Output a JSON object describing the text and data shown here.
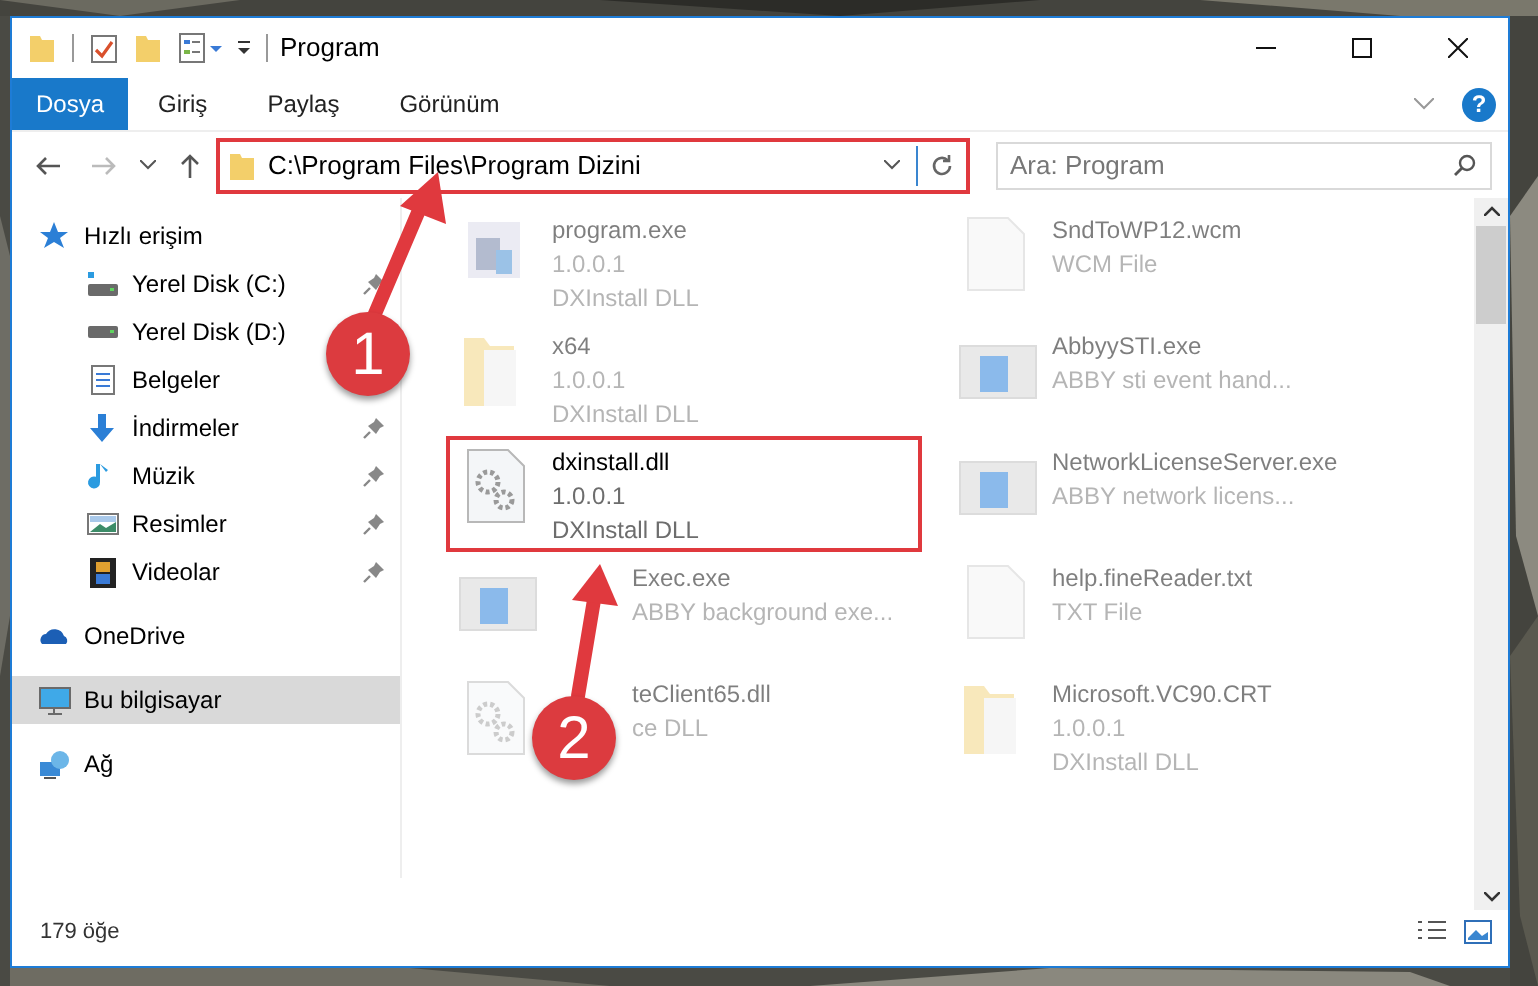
{
  "window": {
    "title": "Program"
  },
  "ribbon": {
    "tabs": [
      {
        "label": "Dosya",
        "selected": true
      },
      {
        "label": "Giriş",
        "selected": false
      },
      {
        "label": "Paylaş",
        "selected": false
      },
      {
        "label": "Görünüm",
        "selected": false
      }
    ],
    "help": "?"
  },
  "address": {
    "path": "C:\\Program Files\\Program Dizini",
    "highlighted": true
  },
  "search": {
    "placeholder": "Ara: Program"
  },
  "sidebar": {
    "items": [
      {
        "label": "Hızlı erişim",
        "kind": "star",
        "selected": false,
        "children": [
          {
            "label": "Yerel Disk (C:)",
            "kind": "system-drive",
            "pinned": true,
            "selected": false
          },
          {
            "label": "Yerel Disk (D:)",
            "kind": "drive",
            "selected": false
          },
          {
            "label": "Belgeler",
            "kind": "documents",
            "selected": false
          },
          {
            "label": "İndirmeler",
            "kind": "downloads",
            "pinned": true,
            "selected": false
          },
          {
            "label": "Müzik",
            "kind": "music",
            "pinned": true,
            "selected": false
          },
          {
            "label": "Resimler",
            "kind": "pictures",
            "pinned": true,
            "selected": false
          },
          {
            "label": "Videolar",
            "kind": "videos",
            "pinned": true,
            "selected": false
          }
        ]
      },
      {
        "label": "OneDrive",
        "kind": "cloud",
        "selected": false
      },
      {
        "label": "Bu bilgisayar",
        "kind": "computer",
        "selected": true
      },
      {
        "label": "Ağ",
        "kind": "network",
        "selected": false
      }
    ]
  },
  "files": [
    {
      "name": "program.exe",
      "lines": [
        "1.0.0.1",
        "DXInstall DLL"
      ],
      "kind": "exe",
      "highlighted": false,
      "occluded": false
    },
    {
      "name": "SndToWP12.wcm",
      "lines": [
        "WCM File"
      ],
      "kind": "file",
      "highlighted": false,
      "occluded": false
    },
    {
      "name": "x64",
      "lines": [
        "1.0.0.1",
        "DXInstall DLL"
      ],
      "kind": "folder",
      "highlighted": false,
      "occluded": false
    },
    {
      "name": "AbbyySTI.exe",
      "lines": [
        "ABBY sti event hand..."
      ],
      "kind": "app",
      "highlighted": false,
      "occluded": false
    },
    {
      "name": "dxinstall.dll",
      "lines": [
        "1.0.0.1",
        "DXInstall DLL"
      ],
      "kind": "dll",
      "highlighted": true,
      "occluded": false
    },
    {
      "name": "NetworkLicenseServer.exe",
      "lines": [
        "ABBY network licens..."
      ],
      "kind": "app",
      "highlighted": false,
      "occluded": false
    },
    {
      "name": "Exec.exe",
      "lines": [
        "ABBY background exe..."
      ],
      "kind": "app",
      "highlighted": false,
      "occluded": true
    },
    {
      "name": "help.fineReader.txt",
      "lines": [
        "TXT File"
      ],
      "kind": "file",
      "highlighted": false,
      "occluded": false
    },
    {
      "name": "teClient65.dll",
      "lines": [
        "ce DLL"
      ],
      "kind": "dll",
      "highlighted": false,
      "occluded": true
    },
    {
      "name": "Microsoft.VC90.CRT",
      "lines": [
        "1.0.0.1",
        "DXInstall DLL"
      ],
      "kind": "folder",
      "highlighted": false,
      "occluded": false
    }
  ],
  "status_bar": {
    "count": "179 öğe"
  },
  "callouts": [
    {
      "number": "1"
    },
    {
      "number": "2"
    }
  ]
}
